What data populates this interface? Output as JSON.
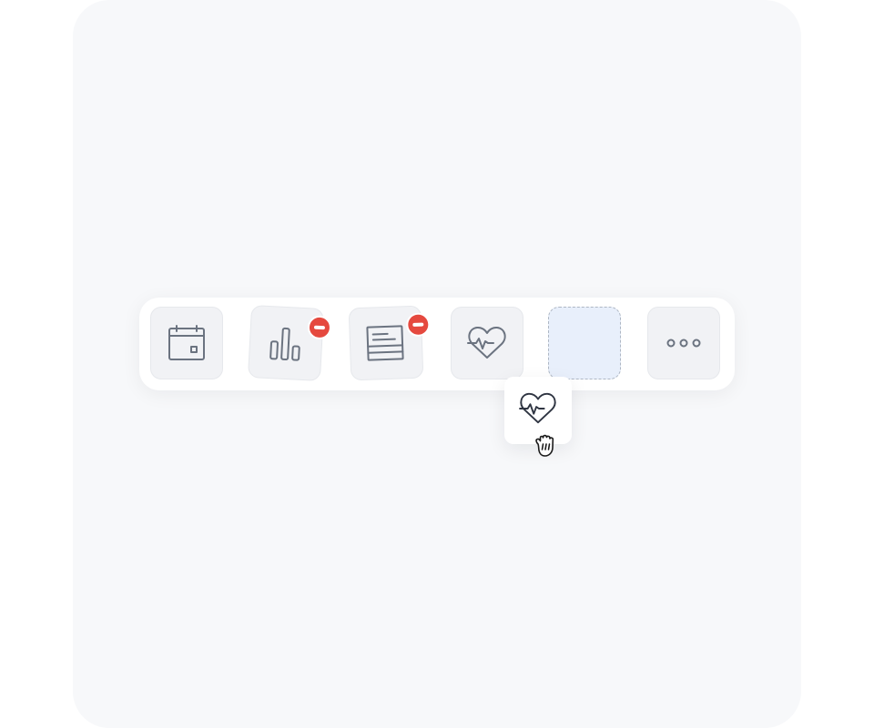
{
  "dock": {
    "tiles": [
      {
        "id": "calendar",
        "icon": "calendar-icon",
        "removable": false
      },
      {
        "id": "stats",
        "icon": "bar-chart-icon",
        "removable": true
      },
      {
        "id": "notes",
        "icon": "document-icon",
        "removable": true
      },
      {
        "id": "health",
        "icon": "heart-pulse-icon",
        "removable": false
      },
      {
        "id": "drop-slot",
        "icon": "none",
        "state": "empty-placeholder"
      },
      {
        "id": "more",
        "icon": "more-icon",
        "removable": false
      }
    ],
    "remove_badge_icon": "minus-icon"
  },
  "drag": {
    "icon": "heart-pulse-icon",
    "cursor_icon": "grab-cursor-icon"
  },
  "colors": {
    "screen_background": "#f7f8fa",
    "dock_background": "#ffffff",
    "tile_background": "#f1f2f5",
    "icon_stroke": "#6b7380",
    "drop_slot_fill": "#e8effb",
    "drop_slot_border": "#aeb7c4",
    "remove_badge": "#e5493f"
  }
}
